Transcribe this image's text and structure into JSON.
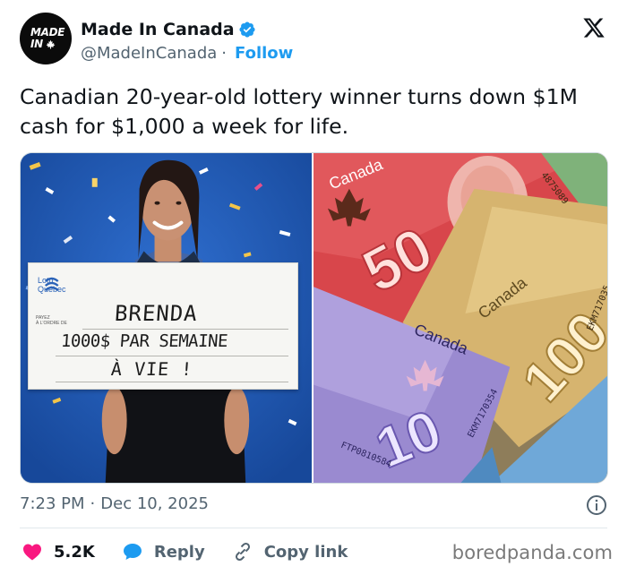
{
  "header": {
    "avatar_line1": "MADE",
    "avatar_line2": "IN",
    "display_name": "Made In Canada",
    "handle": "@MadeInCanada",
    "separator": "·",
    "follow_label": "Follow"
  },
  "tweet": {
    "text": "Canadian 20-year-old lottery winner turns down $1M cash for $1,000 a week for life."
  },
  "media": {
    "left": {
      "brand_line1": "Loto",
      "brand_line2": "Québec",
      "payee_label_1": "PAYEZ",
      "payee_label_2": "À L'ORDRE DE",
      "cheque_name": "BRENDA",
      "cheque_amount": "1000$ PAR SEMAINE",
      "cheque_duration": "À VIE !"
    },
    "right": {
      "note_50_word": "Canada",
      "note_50_value": "50",
      "note_100_word": "Canada",
      "note_100_value": "100",
      "note_10_word": "Canada",
      "note_10_value": "10",
      "serial_1": "4875089",
      "serial_2": "EKM717035",
      "serial_3": "EKM7170354",
      "serial_4": "FTP0810584"
    }
  },
  "footer": {
    "time": "7:23 PM",
    "separator": "·",
    "date": "Dec 10, 2025"
  },
  "actions": {
    "like_count": "5.2K",
    "reply_label": "Reply",
    "copy_label": "Copy link"
  },
  "watermark": "boredpanda.com",
  "colors": {
    "accent": "#1d9bf0",
    "like": "#f91880",
    "text_secondary": "#536471"
  },
  "icons": {
    "verified": "verified-badge-icon",
    "x_logo": "x-logo-icon",
    "info": "info-icon",
    "like": "heart-icon",
    "reply": "speech-bubble-icon",
    "copy": "link-icon"
  }
}
